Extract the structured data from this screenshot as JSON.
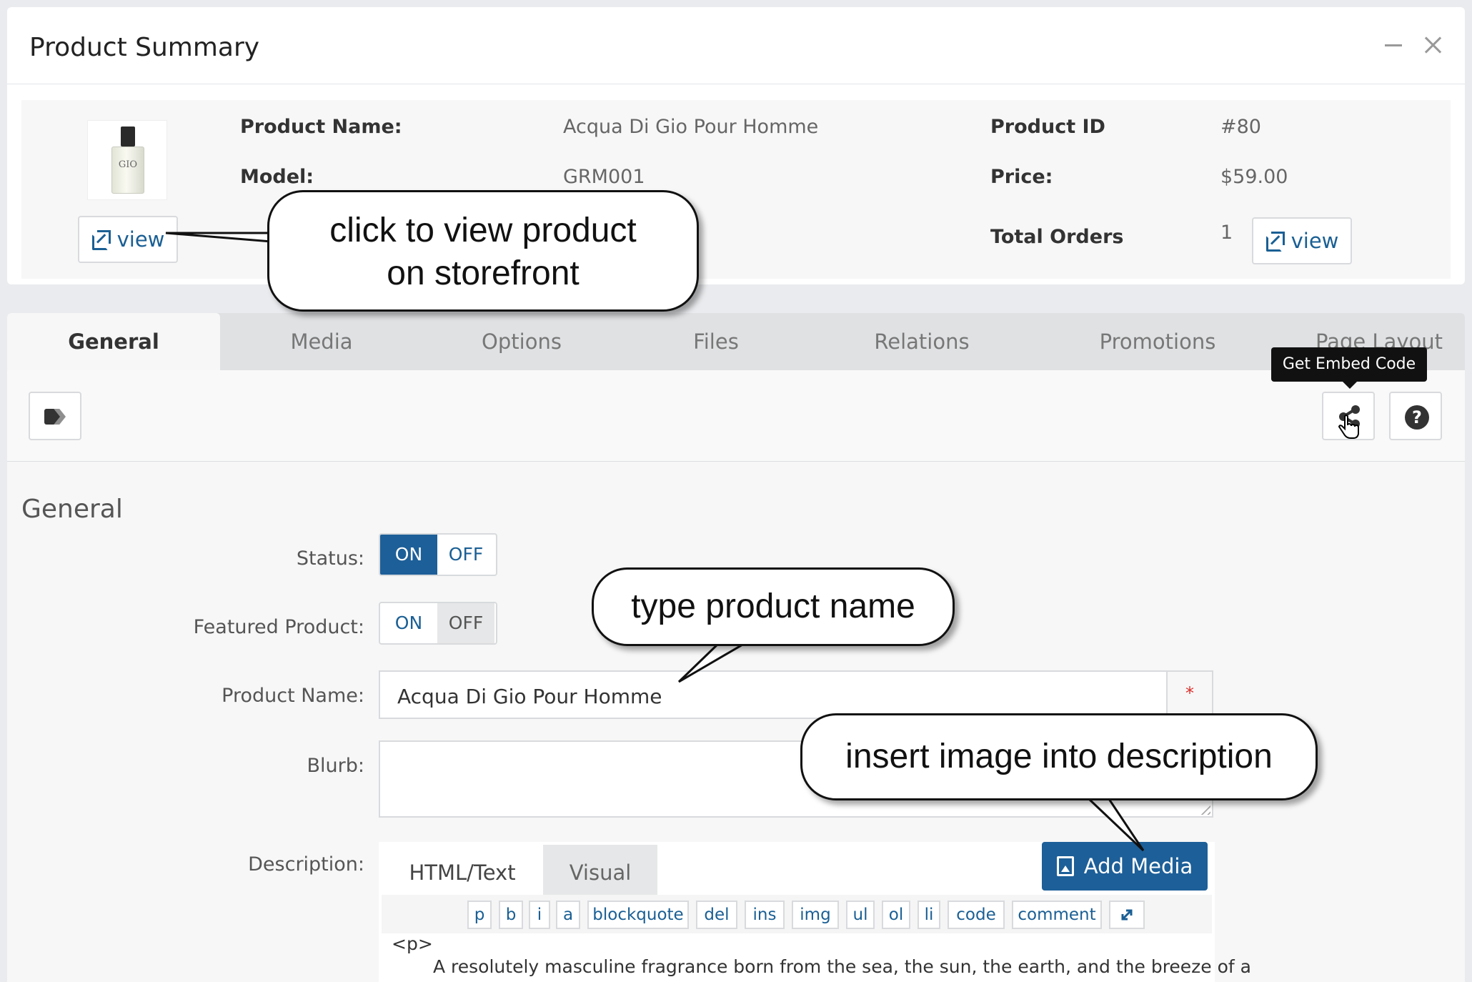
{
  "summary": {
    "title": "Product Summary",
    "product_name_label": "Product Name:",
    "product_name_value": "Acqua Di Gio Pour Homme",
    "model_label": "Model:",
    "model_value": "GRM001",
    "product_id_label": "Product ID",
    "product_id_value": "#80",
    "price_label": "Price:",
    "price_value": "$59.00",
    "total_orders_label": "Total Orders",
    "total_orders_value": "1",
    "view_label": "view",
    "thumbnail_text": "GIO"
  },
  "tabs": [
    "General",
    "Media",
    "Options",
    "Files",
    "Relations",
    "Promotions",
    "Page Layout"
  ],
  "toolbar": {
    "tooltip": "Get Embed Code"
  },
  "general": {
    "section_title": "General",
    "status_label": "Status:",
    "featured_label": "Featured Product:",
    "product_name_label": "Product Name:",
    "product_name_value": "Acqua Di Gio Pour Homme",
    "required_mark": "*",
    "blurb_label": "Blurb:",
    "description_label": "Description:",
    "on": "ON",
    "off": "OFF"
  },
  "editor": {
    "tab_text": "HTML/Text",
    "tab_visual": "Visual",
    "add_media": "Add Media",
    "quicktags": [
      "p",
      "b",
      "i",
      "a",
      "blockquote",
      "del",
      "ins",
      "img",
      "ul",
      "ol",
      "li",
      "code",
      "comment"
    ],
    "content_line1": "<p>",
    "content_line2": "A resolutely masculine fragrance born from the sea, the sun, the earth, and the breeze of a"
  },
  "callouts": {
    "view_storefront_line1": "click to view product",
    "view_storefront_line2": "on storefront",
    "type_name": "type product name",
    "insert_image": "insert image into description"
  },
  "colors": {
    "primary": "#1d5f98",
    "link": "#1a5f94",
    "required": "#d9302c"
  }
}
